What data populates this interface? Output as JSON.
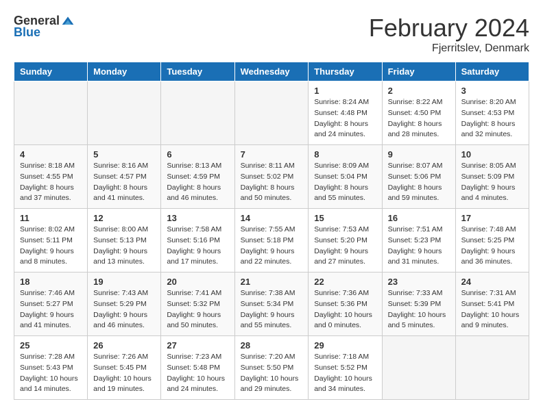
{
  "header": {
    "logo_general": "General",
    "logo_blue": "Blue",
    "month_title": "February 2024",
    "location": "Fjerritslev, Denmark"
  },
  "calendar": {
    "days_header": [
      "Sunday",
      "Monday",
      "Tuesday",
      "Wednesday",
      "Thursday",
      "Friday",
      "Saturday"
    ],
    "weeks": [
      [
        {
          "day": "",
          "info": ""
        },
        {
          "day": "",
          "info": ""
        },
        {
          "day": "",
          "info": ""
        },
        {
          "day": "",
          "info": ""
        },
        {
          "day": "1",
          "info": "Sunrise: 8:24 AM\nSunset: 4:48 PM\nDaylight: 8 hours\nand 24 minutes."
        },
        {
          "day": "2",
          "info": "Sunrise: 8:22 AM\nSunset: 4:50 PM\nDaylight: 8 hours\nand 28 minutes."
        },
        {
          "day": "3",
          "info": "Sunrise: 8:20 AM\nSunset: 4:53 PM\nDaylight: 8 hours\nand 32 minutes."
        }
      ],
      [
        {
          "day": "4",
          "info": "Sunrise: 8:18 AM\nSunset: 4:55 PM\nDaylight: 8 hours\nand 37 minutes."
        },
        {
          "day": "5",
          "info": "Sunrise: 8:16 AM\nSunset: 4:57 PM\nDaylight: 8 hours\nand 41 minutes."
        },
        {
          "day": "6",
          "info": "Sunrise: 8:13 AM\nSunset: 4:59 PM\nDaylight: 8 hours\nand 46 minutes."
        },
        {
          "day": "7",
          "info": "Sunrise: 8:11 AM\nSunset: 5:02 PM\nDaylight: 8 hours\nand 50 minutes."
        },
        {
          "day": "8",
          "info": "Sunrise: 8:09 AM\nSunset: 5:04 PM\nDaylight: 8 hours\nand 55 minutes."
        },
        {
          "day": "9",
          "info": "Sunrise: 8:07 AM\nSunset: 5:06 PM\nDaylight: 8 hours\nand 59 minutes."
        },
        {
          "day": "10",
          "info": "Sunrise: 8:05 AM\nSunset: 5:09 PM\nDaylight: 9 hours\nand 4 minutes."
        }
      ],
      [
        {
          "day": "11",
          "info": "Sunrise: 8:02 AM\nSunset: 5:11 PM\nDaylight: 9 hours\nand 8 minutes."
        },
        {
          "day": "12",
          "info": "Sunrise: 8:00 AM\nSunset: 5:13 PM\nDaylight: 9 hours\nand 13 minutes."
        },
        {
          "day": "13",
          "info": "Sunrise: 7:58 AM\nSunset: 5:16 PM\nDaylight: 9 hours\nand 17 minutes."
        },
        {
          "day": "14",
          "info": "Sunrise: 7:55 AM\nSunset: 5:18 PM\nDaylight: 9 hours\nand 22 minutes."
        },
        {
          "day": "15",
          "info": "Sunrise: 7:53 AM\nSunset: 5:20 PM\nDaylight: 9 hours\nand 27 minutes."
        },
        {
          "day": "16",
          "info": "Sunrise: 7:51 AM\nSunset: 5:23 PM\nDaylight: 9 hours\nand 31 minutes."
        },
        {
          "day": "17",
          "info": "Sunrise: 7:48 AM\nSunset: 5:25 PM\nDaylight: 9 hours\nand 36 minutes."
        }
      ],
      [
        {
          "day": "18",
          "info": "Sunrise: 7:46 AM\nSunset: 5:27 PM\nDaylight: 9 hours\nand 41 minutes."
        },
        {
          "day": "19",
          "info": "Sunrise: 7:43 AM\nSunset: 5:29 PM\nDaylight: 9 hours\nand 46 minutes."
        },
        {
          "day": "20",
          "info": "Sunrise: 7:41 AM\nSunset: 5:32 PM\nDaylight: 9 hours\nand 50 minutes."
        },
        {
          "day": "21",
          "info": "Sunrise: 7:38 AM\nSunset: 5:34 PM\nDaylight: 9 hours\nand 55 minutes."
        },
        {
          "day": "22",
          "info": "Sunrise: 7:36 AM\nSunset: 5:36 PM\nDaylight: 10 hours\nand 0 minutes."
        },
        {
          "day": "23",
          "info": "Sunrise: 7:33 AM\nSunset: 5:39 PM\nDaylight: 10 hours\nand 5 minutes."
        },
        {
          "day": "24",
          "info": "Sunrise: 7:31 AM\nSunset: 5:41 PM\nDaylight: 10 hours\nand 9 minutes."
        }
      ],
      [
        {
          "day": "25",
          "info": "Sunrise: 7:28 AM\nSunset: 5:43 PM\nDaylight: 10 hours\nand 14 minutes."
        },
        {
          "day": "26",
          "info": "Sunrise: 7:26 AM\nSunset: 5:45 PM\nDaylight: 10 hours\nand 19 minutes."
        },
        {
          "day": "27",
          "info": "Sunrise: 7:23 AM\nSunset: 5:48 PM\nDaylight: 10 hours\nand 24 minutes."
        },
        {
          "day": "28",
          "info": "Sunrise: 7:20 AM\nSunset: 5:50 PM\nDaylight: 10 hours\nand 29 minutes."
        },
        {
          "day": "29",
          "info": "Sunrise: 7:18 AM\nSunset: 5:52 PM\nDaylight: 10 hours\nand 34 minutes."
        },
        {
          "day": "",
          "info": ""
        },
        {
          "day": "",
          "info": ""
        }
      ]
    ]
  }
}
